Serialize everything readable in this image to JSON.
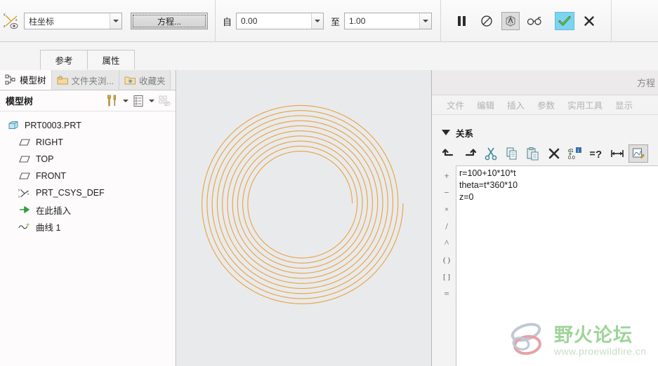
{
  "dashboard": {
    "csys_icon": "coordinate-system-icon",
    "coord_type": "柱坐标",
    "equation_button": "方程...",
    "from_label": "自",
    "from_value": "0.00",
    "to_label": "至",
    "to_value": "1.00",
    "icons": {
      "pause": "pause-icon",
      "no_entry": "no-entry-icon",
      "preview_geometry": "preview-geometry-icon",
      "glasses": "glasses-icon",
      "accept": "accept-check-icon",
      "cancel": "cancel-x-icon"
    }
  },
  "subtabs": [
    {
      "label": "参考"
    },
    {
      "label": "属性"
    }
  ],
  "navigator": {
    "tabs": [
      {
        "label": "模型树",
        "icon": "model-tree-icon",
        "active": true
      },
      {
        "label": "文件夹浏...",
        "icon": "folder-browser-icon",
        "active": false
      },
      {
        "label": "收藏夹",
        "icon": "favorites-folder-icon",
        "active": false
      }
    ],
    "tree_title": "模型树",
    "header_icons": [
      "tools-settings-icon",
      "tools-dropdown-arrow",
      "display-settings-icon",
      "display-dropdown-arrow",
      "filter-hidden-icon"
    ],
    "tree_items": [
      {
        "label": "PRT0003.PRT",
        "icon": "part-icon",
        "indent": 0
      },
      {
        "label": "RIGHT",
        "icon": "datum-plane-icon",
        "indent": 1
      },
      {
        "label": "TOP",
        "icon": "datum-plane-icon",
        "indent": 1
      },
      {
        "label": "FRONT",
        "icon": "datum-plane-icon",
        "indent": 1
      },
      {
        "label": "PRT_CSYS_DEF",
        "icon": "csys-datum-icon",
        "indent": 1
      },
      {
        "label": "在此插入",
        "icon": "insert-here-arrow-icon",
        "indent": 1
      },
      {
        "label": "曲线 1",
        "icon": "curve-icon",
        "indent": 1
      }
    ]
  },
  "graphics": {
    "background_color": "#e9eaec",
    "curve_color": "#e8a23c",
    "curve_type": "archimedean-spiral",
    "turns": 10,
    "r_start": 100,
    "r_end": 200
  },
  "equation_window": {
    "title": "方程",
    "menus": [
      "文件",
      "编辑",
      "插入",
      "参数",
      "实用工具",
      "显示"
    ],
    "section_label": "关系",
    "toolbar_icons": [
      "undo-icon",
      "redo-icon",
      "cut-icon",
      "copy-icon",
      "paste-icon",
      "delete-x-icon",
      "add-dimension-info-icon",
      "verify-relations-icon",
      "dimension-measure-icon",
      "sketch-relations-icon"
    ],
    "operator_buttons": [
      "+",
      "−",
      "×",
      "/",
      "^",
      "( )",
      "[ ]",
      "="
    ],
    "equations": [
      "r=100+10*10*t",
      "theta=t*360*10",
      "z=0"
    ]
  },
  "watermark": {
    "title": "野火论坛",
    "url": "www.proewildfire.cn",
    "logo": "butterfly-logo-icon"
  }
}
